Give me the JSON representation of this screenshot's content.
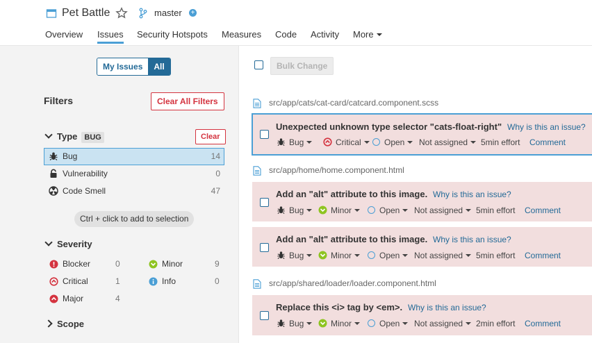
{
  "project": {
    "name": "Pet Battle",
    "branch": "master"
  },
  "nav": {
    "overview": "Overview",
    "issues": "Issues",
    "hotspots": "Security Hotspots",
    "measures": "Measures",
    "code": "Code",
    "activity": "Activity",
    "more": "More"
  },
  "sidebar": {
    "my_issues": "My Issues",
    "all": "All",
    "filters_title": "Filters",
    "clear_all": "Clear All Filters",
    "type_facet": {
      "title": "Type",
      "badge": "BUG",
      "clear": "Clear",
      "items": [
        {
          "label": "Bug",
          "count": "14"
        },
        {
          "label": "Vulnerability",
          "count": "0"
        },
        {
          "label": "Code Smell",
          "count": "47"
        }
      ]
    },
    "hint": "Ctrl + click to add to selection",
    "severity_facet": {
      "title": "Severity",
      "items": [
        {
          "label": "Blocker",
          "count": "0"
        },
        {
          "label": "Minor",
          "count": "9"
        },
        {
          "label": "Critical",
          "count": "1"
        },
        {
          "label": "Info",
          "count": "0"
        },
        {
          "label": "Major",
          "count": "4"
        }
      ]
    },
    "scope_title": "Scope"
  },
  "main": {
    "bulk_change": "Bulk Change",
    "files": [
      "src/app/cats/cat-card/catcard.component.scss",
      "src/app/home/home.component.html",
      "src/app/shared/loader/loader.component.html"
    ],
    "issues": [
      {
        "message": "Unexpected unknown type selector \"cats-float-right\"",
        "why": "Why is this an issue?",
        "type": "Bug",
        "severity": "Critical",
        "status": "Open",
        "assignee": "Not assigned",
        "effort": "5min effort",
        "comment": "Comment"
      },
      {
        "message": "Add an \"alt\" attribute to this image.",
        "why": "Why is this an issue?",
        "type": "Bug",
        "severity": "Minor",
        "status": "Open",
        "assignee": "Not assigned",
        "effort": "5min effort",
        "comment": "Comment"
      },
      {
        "message": "Add an \"alt\" attribute to this image.",
        "why": "Why is this an issue?",
        "type": "Bug",
        "severity": "Minor",
        "status": "Open",
        "assignee": "Not assigned",
        "effort": "5min effort",
        "comment": "Comment"
      },
      {
        "message": "Replace this <i> tag by <em>.",
        "why": "Why is this an issue?",
        "type": "Bug",
        "severity": "Minor",
        "status": "Open",
        "assignee": "Not assigned",
        "effort": "2min effort",
        "comment": "Comment"
      }
    ]
  },
  "colors": {
    "accent": "#4b9fd5",
    "link": "#236a97",
    "danger": "#d4333f",
    "issue_bg": "#f2dede",
    "minor": "#8ec421"
  }
}
